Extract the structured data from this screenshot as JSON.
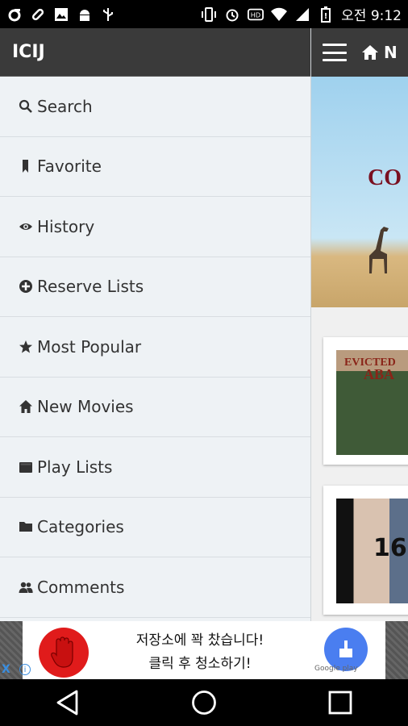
{
  "statusbar": {
    "time": "오전 9:12",
    "icons_left": [
      "notification-icon",
      "link-icon",
      "image-icon",
      "android-icon",
      "usb-icon"
    ],
    "icons_right": [
      "vibrate-icon",
      "alarm-icon",
      "hd-icon",
      "wifi-icon",
      "signal-icon",
      "battery-icon"
    ]
  },
  "drawer": {
    "title": "ICIJ",
    "items": [
      {
        "label": "Search",
        "icon": "search-icon"
      },
      {
        "label": "Favorite",
        "icon": "bookmark-icon"
      },
      {
        "label": "History",
        "icon": "eye-icon"
      },
      {
        "label": "Reserve Lists",
        "icon": "plus-circle-icon"
      },
      {
        "label": "Most Popular",
        "icon": "star-icon"
      },
      {
        "label": "New Movies",
        "icon": "home-icon"
      },
      {
        "label": "Play Lists",
        "icon": "film-icon"
      },
      {
        "label": "Categories",
        "icon": "folder-icon"
      },
      {
        "label": "Comments",
        "icon": "users-icon"
      }
    ]
  },
  "content": {
    "top_label": "N",
    "banner_text": "CO",
    "card1_title_line1": "EVICTED",
    "card1_title_line2": "ABA",
    "card2_text": "16"
  },
  "ad": {
    "line1": "저장소에 꽉 찼습니다!",
    "line2": "클릭 후 청소하기!",
    "store": "Google play",
    "close": "X",
    "info": "i"
  }
}
